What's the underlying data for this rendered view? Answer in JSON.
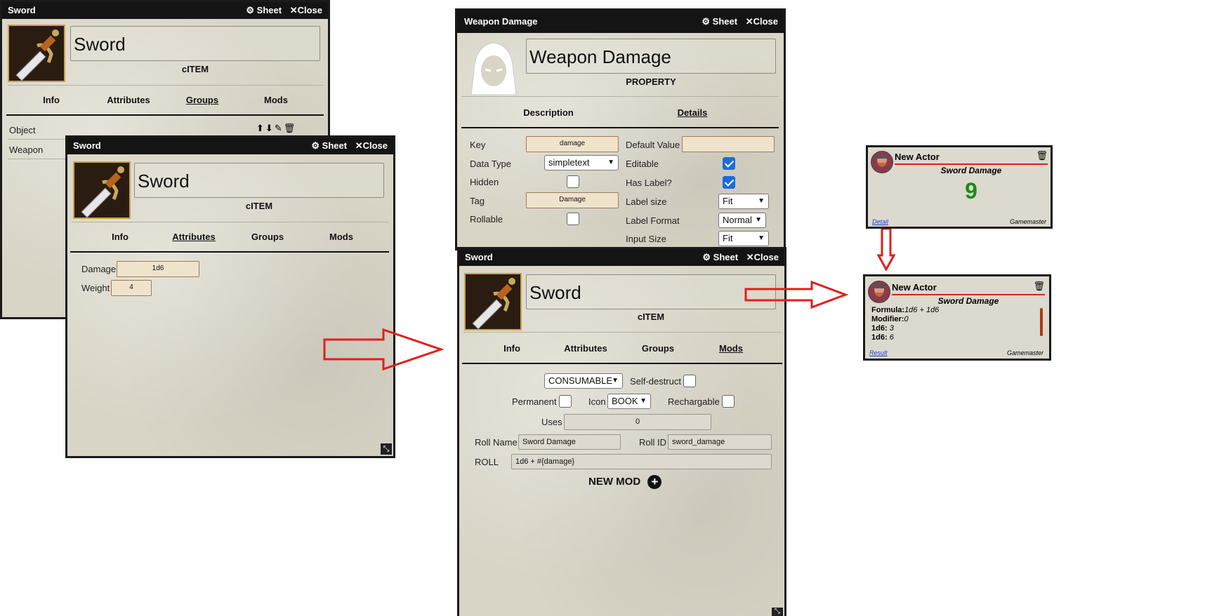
{
  "common": {
    "sheet_label": "Sheet",
    "close_label": "Close"
  },
  "win1": {
    "title": "Sword",
    "name": "Sword",
    "type": "cITEM",
    "tabs": [
      "Info",
      "Attributes",
      "Groups",
      "Mods"
    ],
    "active_tab": "Groups",
    "groups": [
      "Object",
      "Weapon"
    ]
  },
  "win2": {
    "title": "Sword",
    "name": "Sword",
    "type": "cITEM",
    "tabs": [
      "Info",
      "Attributes",
      "Groups",
      "Mods"
    ],
    "active_tab": "Attributes",
    "attrs": [
      {
        "label": "Damage",
        "value": "1d6"
      },
      {
        "label": "Weight",
        "value": "4"
      }
    ]
  },
  "win3": {
    "title": "Weapon Damage",
    "name": "Weapon Damage",
    "type": "PROPERTY",
    "tabs": [
      "Description",
      "Details"
    ],
    "active_tab": "Details",
    "key_label": "Key",
    "key_value": "damage",
    "datatype_label": "Data Type",
    "datatype_value": "simpletext",
    "hidden_label": "Hidden",
    "tag_label": "Tag",
    "tag_value": "Damage",
    "rollable_label": "Rollable",
    "default_label": "Default Value",
    "editable_label": "Editable",
    "haslabel_label": "Has Label?",
    "labelsize_label": "Label size",
    "labelsize_value": "Fit",
    "labelformat_label": "Label Format",
    "labelformat_value": "Normal",
    "inputsize_label": "Input Size",
    "inputsize_value": "Fit"
  },
  "win4": {
    "title": "Sword",
    "name": "Sword",
    "type": "cITEM",
    "tabs": [
      "Info",
      "Attributes",
      "Groups",
      "Mods"
    ],
    "active_tab": "Mods",
    "consumable_value": "CONSUMABLE",
    "selfdestruct_label": "Self-destruct",
    "permanent_label": "Permanent",
    "icon_label": "Icon",
    "icon_value": "BOOK",
    "rechargable_label": "Rechargable",
    "uses_label": "Uses",
    "uses_value": "0",
    "rollname_label": "Roll Name",
    "rollname_value": "Sword Damage",
    "rollid_label": "Roll ID",
    "rollid_value": "sword_damage",
    "roll_label": "ROLL",
    "roll_value": "1d6 + #{damage}",
    "newmod_label": "NEW MOD"
  },
  "card1": {
    "actor": "New Actor",
    "roll_title": "Sword Damage",
    "result": "9",
    "detail_link": "Detail",
    "user": "Gamemaster"
  },
  "card2": {
    "actor": "New Actor",
    "roll_title": "Sword Damage",
    "lines": [
      {
        "key": "Formula:",
        "val": "1d6 + 1d6"
      },
      {
        "key": "Modifier:",
        "val": "0"
      },
      {
        "key": "1d6:",
        "val": "3"
      },
      {
        "key": "1d6:",
        "val": "6"
      }
    ],
    "result_link": "Result",
    "user": "Gamemaster"
  },
  "colors": {
    "arrow": "#e0201b",
    "accent_bar": "#e0201b",
    "result_green": "#1a8a1a",
    "checkbox_blue": "#1a6be0"
  },
  "icons": [
    "gear-icon",
    "close-icon",
    "sword-icon",
    "hooded-figure-icon",
    "plus-circle-icon",
    "trash-icon",
    "edit-icon",
    "arrow-up-circle-icon",
    "arrow-down-circle-icon",
    "resize-icon",
    "dwarf-avatar-icon"
  ]
}
